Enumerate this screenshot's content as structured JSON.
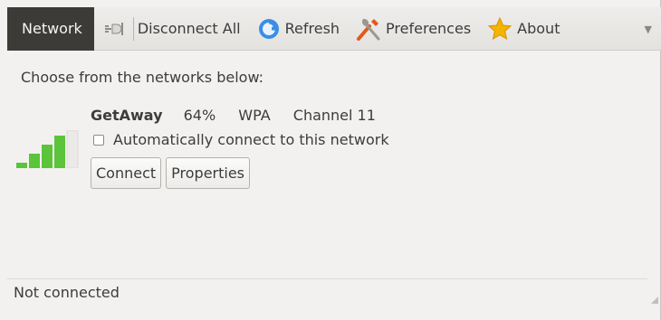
{
  "toolbar": {
    "network_tab": "Network",
    "disconnect_all": "Disconnect All",
    "refresh": "Refresh",
    "preferences": "Preferences",
    "about": "About",
    "icons": {
      "disconnect": "unplug-icon",
      "refresh": "refresh-icon",
      "preferences": "tools-icon",
      "about": "star-icon",
      "overflow": "chevron-down-icon"
    }
  },
  "prompt": "Choose from the networks below:",
  "network": {
    "name": "GetAway",
    "strength": "64%",
    "security": "WPA",
    "channel": "Channel 11",
    "auto_connect_label": "Automatically connect to this network",
    "auto_connect_checked": false,
    "connect_label": "Connect",
    "properties_label": "Properties",
    "signal_level": 0.64
  },
  "status": "Not connected",
  "colors": {
    "tab_active_bg": "#3c3b37",
    "signal_on": "#5cc43a",
    "signal_off": "#e8e8e6",
    "star": "#f4b400",
    "refresh": "#3a8ee6"
  }
}
